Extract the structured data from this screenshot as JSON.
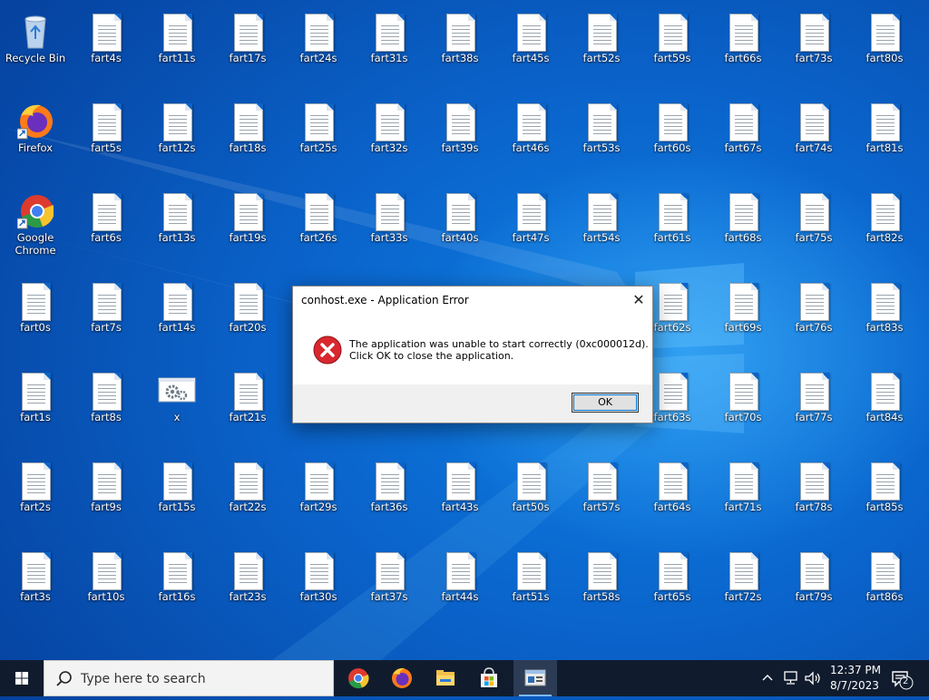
{
  "desktop": {
    "icons": [
      {
        "name": "recycle-bin-icon",
        "label": "Recycle Bin",
        "kind": "recycle",
        "col": 0,
        "row": 0
      },
      {
        "name": "firefox-icon",
        "label": "Firefox",
        "kind": "firefox",
        "col": 0,
        "row": 1
      },
      {
        "name": "chrome-icon",
        "label": "Google Chrome",
        "kind": "chrome",
        "col": 0,
        "row": 2
      },
      {
        "name": "file-icon",
        "label": "fart0s",
        "kind": "doc",
        "col": 0,
        "row": 3
      },
      {
        "name": "file-icon",
        "label": "fart1s",
        "kind": "doc",
        "col": 0,
        "row": 4
      },
      {
        "name": "file-icon",
        "label": "fart2s",
        "kind": "doc",
        "col": 0,
        "row": 5
      },
      {
        "name": "file-icon",
        "label": "fart3s",
        "kind": "doc",
        "col": 0,
        "row": 6
      },
      {
        "name": "file-icon",
        "label": "fart4s",
        "kind": "doc",
        "col": 1,
        "row": 0
      },
      {
        "name": "file-icon",
        "label": "fart5s",
        "kind": "doc",
        "col": 1,
        "row": 1
      },
      {
        "name": "file-icon",
        "label": "fart6s",
        "kind": "doc",
        "col": 1,
        "row": 2
      },
      {
        "name": "file-icon",
        "label": "fart7s",
        "kind": "doc",
        "col": 1,
        "row": 3
      },
      {
        "name": "file-icon",
        "label": "fart8s",
        "kind": "doc",
        "col": 1,
        "row": 4
      },
      {
        "name": "file-icon",
        "label": "fart9s",
        "kind": "doc",
        "col": 1,
        "row": 5
      },
      {
        "name": "file-icon",
        "label": "fart10s",
        "kind": "doc",
        "col": 1,
        "row": 6
      },
      {
        "name": "file-icon",
        "label": "fart11s",
        "kind": "doc",
        "col": 2,
        "row": 0
      },
      {
        "name": "file-icon",
        "label": "fart12s",
        "kind": "doc",
        "col": 2,
        "row": 1
      },
      {
        "name": "file-icon",
        "label": "fart13s",
        "kind": "doc",
        "col": 2,
        "row": 2
      },
      {
        "name": "file-icon",
        "label": "fart14s",
        "kind": "doc",
        "col": 2,
        "row": 3
      },
      {
        "name": "settings-file-icon",
        "label": "x",
        "kind": "gear",
        "col": 2,
        "row": 4
      },
      {
        "name": "file-icon",
        "label": "fart15s",
        "kind": "doc",
        "col": 2,
        "row": 5
      },
      {
        "name": "file-icon",
        "label": "fart16s",
        "kind": "doc",
        "col": 2,
        "row": 6
      },
      {
        "name": "file-icon",
        "label": "fart17s",
        "kind": "doc",
        "col": 3,
        "row": 0
      },
      {
        "name": "file-icon",
        "label": "fart18s",
        "kind": "doc",
        "col": 3,
        "row": 1
      },
      {
        "name": "file-icon",
        "label": "fart19s",
        "kind": "doc",
        "col": 3,
        "row": 2
      },
      {
        "name": "file-icon",
        "label": "fart20s",
        "kind": "doc",
        "col": 3,
        "row": 3
      },
      {
        "name": "file-icon",
        "label": "fart21s",
        "kind": "doc",
        "col": 3,
        "row": 4
      },
      {
        "name": "file-icon",
        "label": "fart22s",
        "kind": "doc",
        "col": 3,
        "row": 5
      },
      {
        "name": "file-icon",
        "label": "fart23s",
        "kind": "doc",
        "col": 3,
        "row": 6
      },
      {
        "name": "file-icon",
        "label": "fart24s",
        "kind": "doc",
        "col": 4,
        "row": 0
      },
      {
        "name": "file-icon",
        "label": "fart25s",
        "kind": "doc",
        "col": 4,
        "row": 1
      },
      {
        "name": "file-icon",
        "label": "fart26s",
        "kind": "doc",
        "col": 4,
        "row": 2
      },
      {
        "name": "file-icon",
        "label": "fart29s",
        "kind": "doc",
        "col": 4,
        "row": 5
      },
      {
        "name": "file-icon",
        "label": "fart30s",
        "kind": "doc",
        "col": 4,
        "row": 6
      },
      {
        "name": "file-icon",
        "label": "fart31s",
        "kind": "doc",
        "col": 5,
        "row": 0
      },
      {
        "name": "file-icon",
        "label": "fart32s",
        "kind": "doc",
        "col": 5,
        "row": 1
      },
      {
        "name": "file-icon",
        "label": "fart33s",
        "kind": "doc",
        "col": 5,
        "row": 2
      },
      {
        "name": "file-icon",
        "label": "fart36s",
        "kind": "doc",
        "col": 5,
        "row": 5
      },
      {
        "name": "file-icon",
        "label": "fart37s",
        "kind": "doc",
        "col": 5,
        "row": 6
      },
      {
        "name": "file-icon",
        "label": "fart38s",
        "kind": "doc",
        "col": 6,
        "row": 0
      },
      {
        "name": "file-icon",
        "label": "fart39s",
        "kind": "doc",
        "col": 6,
        "row": 1
      },
      {
        "name": "file-icon",
        "label": "fart40s",
        "kind": "doc",
        "col": 6,
        "row": 2
      },
      {
        "name": "file-icon",
        "label": "fart43s",
        "kind": "doc",
        "col": 6,
        "row": 5
      },
      {
        "name": "file-icon",
        "label": "fart44s",
        "kind": "doc",
        "col": 6,
        "row": 6
      },
      {
        "name": "file-icon",
        "label": "fart45s",
        "kind": "doc",
        "col": 7,
        "row": 0
      },
      {
        "name": "file-icon",
        "label": "fart46s",
        "kind": "doc",
        "col": 7,
        "row": 1
      },
      {
        "name": "file-icon",
        "label": "fart47s",
        "kind": "doc",
        "col": 7,
        "row": 2
      },
      {
        "name": "file-icon",
        "label": "fart50s",
        "kind": "doc",
        "col": 7,
        "row": 5
      },
      {
        "name": "file-icon",
        "label": "fart51s",
        "kind": "doc",
        "col": 7,
        "row": 6
      },
      {
        "name": "file-icon",
        "label": "fart52s",
        "kind": "doc",
        "col": 8,
        "row": 0
      },
      {
        "name": "file-icon",
        "label": "fart53s",
        "kind": "doc",
        "col": 8,
        "row": 1
      },
      {
        "name": "file-icon",
        "label": "fart54s",
        "kind": "doc",
        "col": 8,
        "row": 2
      },
      {
        "name": "file-icon",
        "label": "fart57s",
        "kind": "doc",
        "col": 8,
        "row": 5
      },
      {
        "name": "file-icon",
        "label": "fart58s",
        "kind": "doc",
        "col": 8,
        "row": 6
      },
      {
        "name": "file-icon",
        "label": "fart59s",
        "kind": "doc",
        "col": 9,
        "row": 0
      },
      {
        "name": "file-icon",
        "label": "fart60s",
        "kind": "doc",
        "col": 9,
        "row": 1
      },
      {
        "name": "file-icon",
        "label": "fart61s",
        "kind": "doc",
        "col": 9,
        "row": 2
      },
      {
        "name": "file-icon",
        "label": "fart62s",
        "kind": "doc",
        "col": 9,
        "row": 3
      },
      {
        "name": "file-icon",
        "label": "fart63s",
        "kind": "doc",
        "col": 9,
        "row": 4
      },
      {
        "name": "file-icon",
        "label": "fart64s",
        "kind": "doc",
        "col": 9,
        "row": 5
      },
      {
        "name": "file-icon",
        "label": "fart65s",
        "kind": "doc",
        "col": 9,
        "row": 6
      },
      {
        "name": "file-icon",
        "label": "fart66s",
        "kind": "doc",
        "col": 10,
        "row": 0
      },
      {
        "name": "file-icon",
        "label": "fart67s",
        "kind": "doc",
        "col": 10,
        "row": 1
      },
      {
        "name": "file-icon",
        "label": "fart68s",
        "kind": "doc",
        "col": 10,
        "row": 2
      },
      {
        "name": "file-icon",
        "label": "fart69s",
        "kind": "doc",
        "col": 10,
        "row": 3
      },
      {
        "name": "file-icon",
        "label": "fart70s",
        "kind": "doc",
        "col": 10,
        "row": 4
      },
      {
        "name": "file-icon",
        "label": "fart71s",
        "kind": "doc",
        "col": 10,
        "row": 5
      },
      {
        "name": "file-icon",
        "label": "fart72s",
        "kind": "doc",
        "col": 10,
        "row": 6
      },
      {
        "name": "file-icon",
        "label": "fart73s",
        "kind": "doc",
        "col": 11,
        "row": 0
      },
      {
        "name": "file-icon",
        "label": "fart74s",
        "kind": "doc",
        "col": 11,
        "row": 1
      },
      {
        "name": "file-icon",
        "label": "fart75s",
        "kind": "doc",
        "col": 11,
        "row": 2
      },
      {
        "name": "file-icon",
        "label": "fart76s",
        "kind": "doc",
        "col": 11,
        "row": 3
      },
      {
        "name": "file-icon",
        "label": "fart77s",
        "kind": "doc",
        "col": 11,
        "row": 4
      },
      {
        "name": "file-icon",
        "label": "fart78s",
        "kind": "doc",
        "col": 11,
        "row": 5
      },
      {
        "name": "file-icon",
        "label": "fart79s",
        "kind": "doc",
        "col": 11,
        "row": 6
      },
      {
        "name": "file-icon",
        "label": "fart80s",
        "kind": "doc",
        "col": 12,
        "row": 0
      },
      {
        "name": "file-icon",
        "label": "fart81s",
        "kind": "doc",
        "col": 12,
        "row": 1
      },
      {
        "name": "file-icon",
        "label": "fart82s",
        "kind": "doc",
        "col": 12,
        "row": 2
      },
      {
        "name": "file-icon",
        "label": "fart83s",
        "kind": "doc",
        "col": 12,
        "row": 3
      },
      {
        "name": "file-icon",
        "label": "fart84s",
        "kind": "doc",
        "col": 12,
        "row": 4
      },
      {
        "name": "file-icon",
        "label": "fart85s",
        "kind": "doc",
        "col": 12,
        "row": 5
      },
      {
        "name": "file-icon",
        "label": "fart86s",
        "kind": "doc",
        "col": 12,
        "row": 6
      }
    ]
  },
  "dialog": {
    "title": "conhost.exe - Application Error",
    "message_line1": "The application was unable to start correctly (0xc000012d).",
    "message_line2": "Click OK to close the application.",
    "ok_label": "OK",
    "close_glyph": "✕"
  },
  "taskbar": {
    "search_placeholder": "Type here to search",
    "apps": [
      "chrome-icon",
      "firefox-icon",
      "file-explorer-icon",
      "store-icon",
      "conhost-icon"
    ],
    "time": "12:37 PM",
    "date": "8/7/2023",
    "notification_count": "2"
  },
  "colors": {
    "desktop_blue": "#0a62c9",
    "taskbar": "#101c2e",
    "error_red": "#d9272e",
    "accent": "#0078d7"
  }
}
